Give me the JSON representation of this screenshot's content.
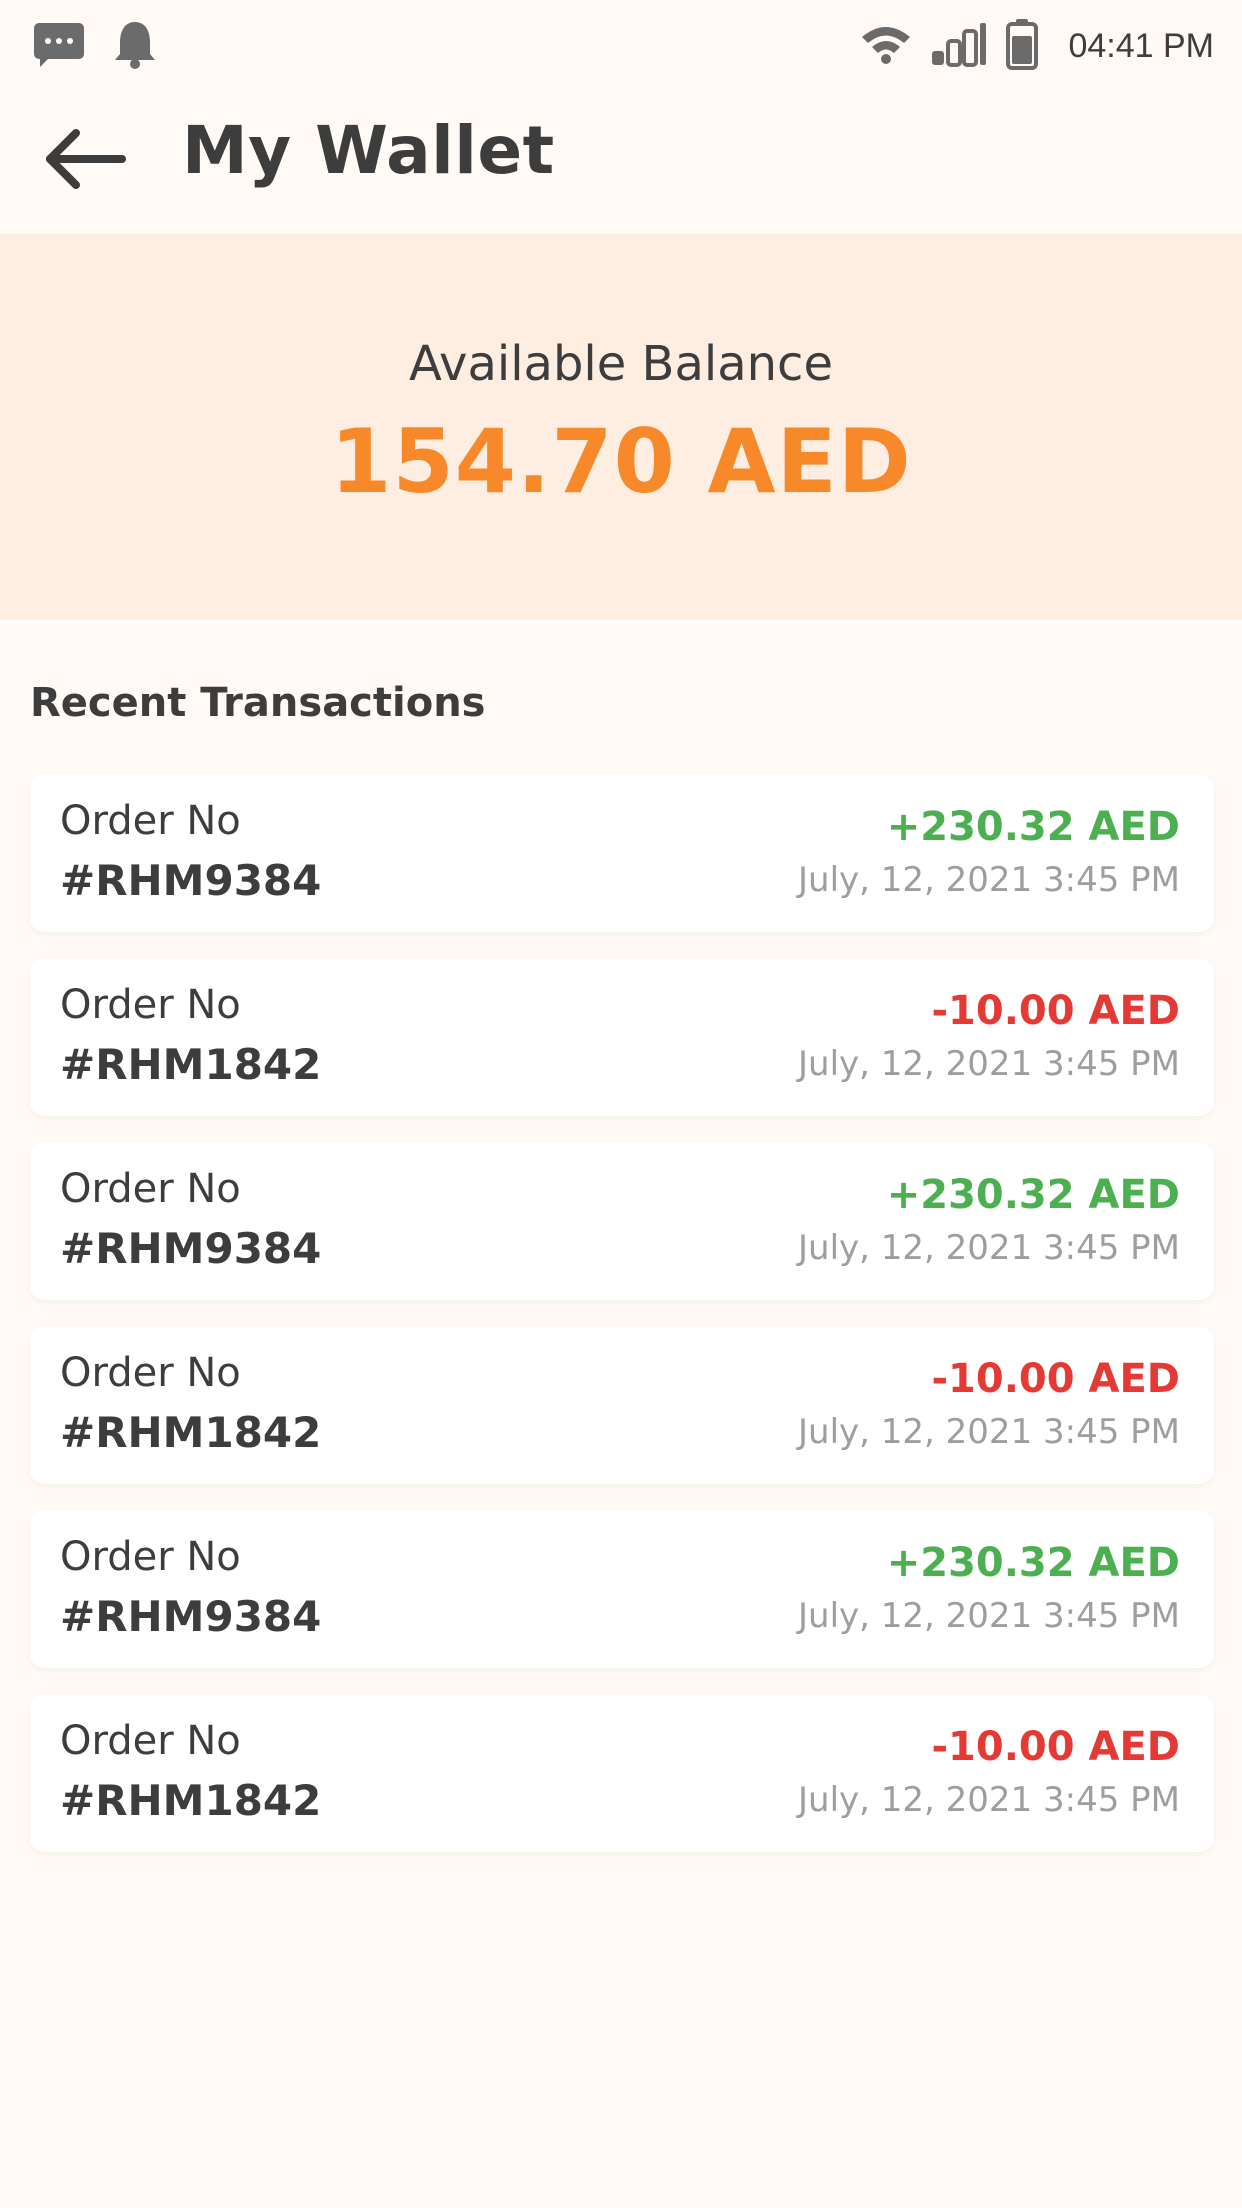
{
  "status_bar": {
    "time": "04:41 PM",
    "icons": [
      "message-icon",
      "notification-bell-icon",
      "wifi-icon",
      "signal-icon",
      "battery-icon"
    ]
  },
  "header": {
    "title": "My Wallet",
    "back_icon": "arrow-left-icon"
  },
  "balance": {
    "label": "Available Balance",
    "amount": "154.70 AED",
    "accent_color": "#f7892b",
    "background_color": "#fdeee1"
  },
  "transactions": {
    "section_title": "Recent Transactions",
    "items": [
      {
        "label": "Order No",
        "order": "#RHM9384",
        "amount": "+230.32 AED",
        "type": "credit",
        "date": "July, 12, 2021 3:45 PM"
      },
      {
        "label": "Order No",
        "order": "#RHM1842",
        "amount": "-10.00 AED",
        "type": "debit",
        "date": "July, 12, 2021 3:45 PM"
      },
      {
        "label": "Order No",
        "order": "#RHM9384",
        "amount": "+230.32 AED",
        "type": "credit",
        "date": "July, 12, 2021 3:45 PM"
      },
      {
        "label": "Order No",
        "order": "#RHM1842",
        "amount": "-10.00 AED",
        "type": "debit",
        "date": "July, 12, 2021 3:45 PM"
      },
      {
        "label": "Order No",
        "order": "#RHM9384",
        "amount": "+230.32 AED",
        "type": "credit",
        "date": "July, 12, 2021 3:45 PM"
      },
      {
        "label": "Order No",
        "order": "#RHM1842",
        "amount": "-10.00 AED",
        "type": "debit",
        "date": "July, 12, 2021 3:45 PM"
      }
    ],
    "colors": {
      "credit": "#4caf50",
      "debit": "#e53935"
    }
  }
}
